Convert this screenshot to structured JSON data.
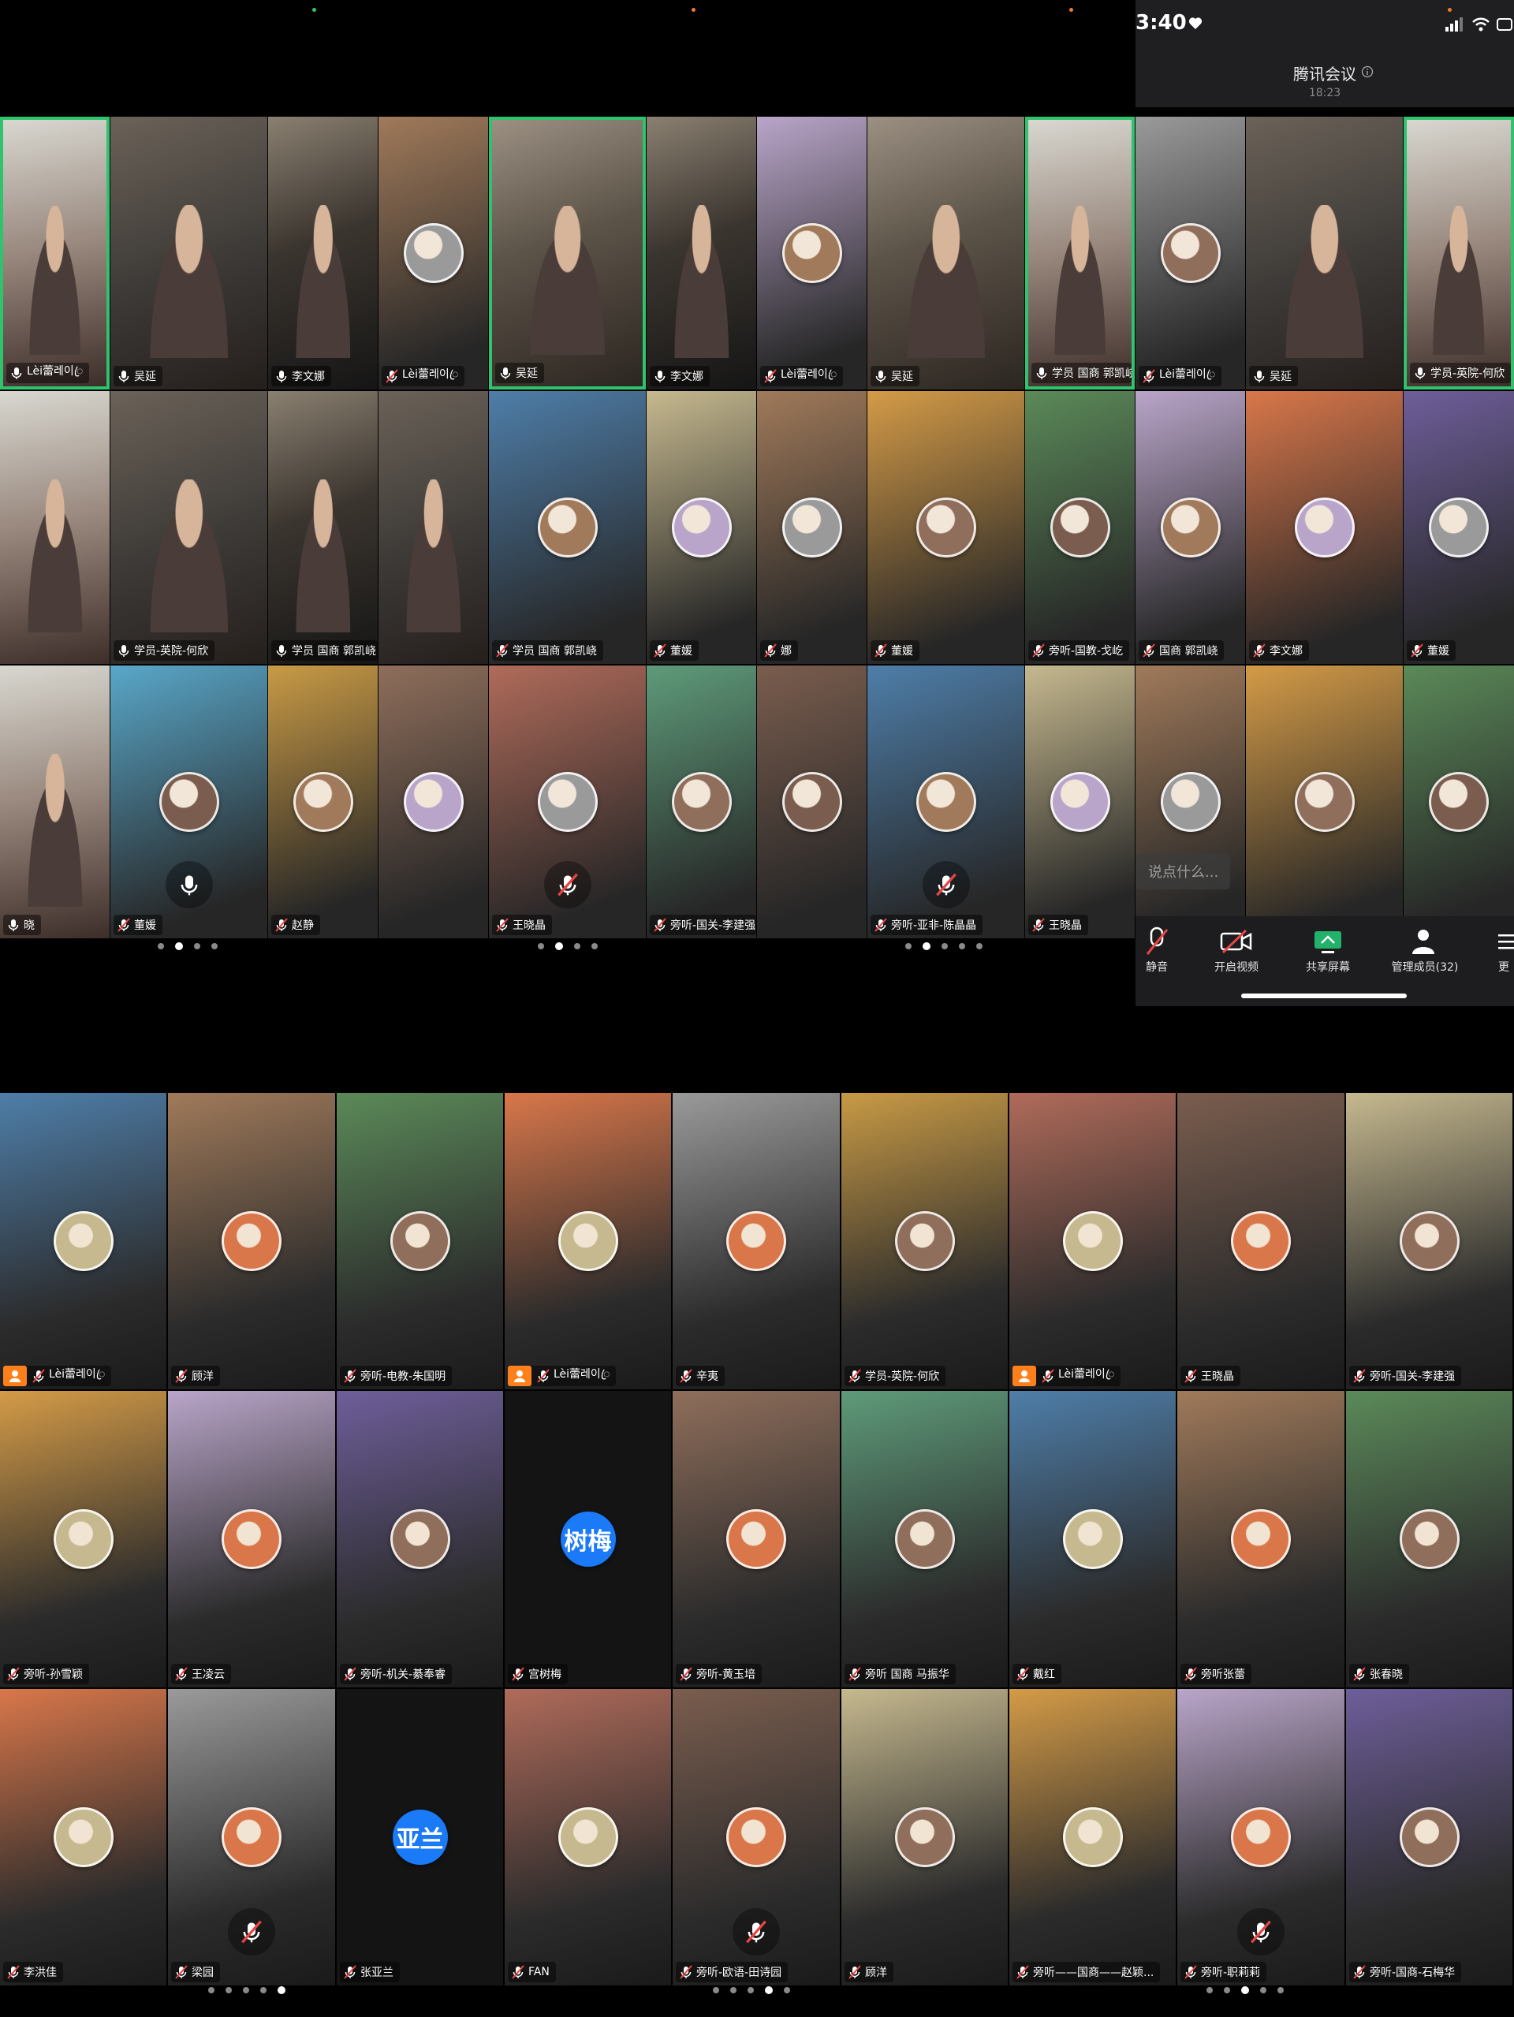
{
  "status": {
    "time": "3:40",
    "meeting_title": "腾讯会议",
    "duration": "18:23"
  },
  "chat": {
    "placeholder": "说点什么..."
  },
  "toolbar": {
    "mute": "静音",
    "video": "开启视频",
    "share": "共享屏幕",
    "members": "管理成员(32)",
    "more": "更"
  },
  "top_tiles": [
    {
      "name": "Lèi蕾레이ꦿ",
      "kind": "video"
    },
    {
      "name": "吴延",
      "kind": "video"
    },
    {
      "name": "李文娜",
      "kind": "video"
    },
    {
      "name": "Lèi蕾레이ꦿ",
      "kind": "avatar"
    },
    {
      "name": "吴延",
      "kind": "video"
    },
    {
      "name": "李文娜",
      "kind": "video"
    },
    {
      "name": "Lèi蕾레이ꦿ",
      "kind": "avatar"
    },
    {
      "name": "吴延",
      "kind": "video"
    },
    {
      "name": "学员 国商 郭凯峣",
      "kind": "video"
    },
    {
      "name": "Lèi蕾레이ꦿ",
      "kind": "avatar"
    },
    {
      "name": "吴延",
      "kind": "video"
    },
    {
      "name": "学员-英院-何欣",
      "kind": "video"
    },
    {
      "name": "",
      "kind": "video"
    },
    {
      "name": "学员-英院-何欣",
      "kind": "video"
    },
    {
      "name": "学员 国商 郭凯峣",
      "kind": "video"
    },
    {
      "name": "",
      "kind": "video"
    },
    {
      "name": "学员 国商 郭凯峣",
      "kind": "avatar"
    },
    {
      "name": "董媛",
      "kind": "avatar"
    },
    {
      "name": "娜",
      "kind": "avatar"
    },
    {
      "name": "董媛",
      "kind": "avatar"
    },
    {
      "name": "旁听-国教-戈屹",
      "kind": "avatar"
    },
    {
      "name": "国商 郭凯峣",
      "kind": "avatar"
    },
    {
      "name": "李文娜",
      "kind": "avatar"
    },
    {
      "name": "董媛",
      "kind": "avatar"
    },
    {
      "name": "晓",
      "kind": "video"
    },
    {
      "name": "董媛",
      "kind": "avatar"
    },
    {
      "name": "赵静",
      "kind": "avatar"
    },
    {
      "name": "",
      "kind": "avatar"
    },
    {
      "name": "王晓晶",
      "kind": "avatar"
    },
    {
      "name": "旁听-国关-李建强",
      "kind": "avatar"
    },
    {
      "name": "",
      "kind": "avatar"
    },
    {
      "name": "旁听-亚非-陈晶晶",
      "kind": "avatar"
    },
    {
      "name": "王晓晶",
      "kind": "avatar"
    },
    {
      "name": "",
      "kind": "avatar"
    },
    {
      "name": "",
      "kind": "avatar"
    },
    {
      "name": "",
      "kind": "avatar"
    }
  ],
  "bottom_tiles": [
    {
      "name": "Lèi蕾레이ꦿ",
      "host": true,
      "avatar_text": ""
    },
    {
      "name": "顾洋",
      "host": false,
      "avatar_text": ""
    },
    {
      "name": "旁听-电教-朱国明",
      "host": false,
      "avatar_text": ""
    },
    {
      "name": "Lèi蕾레이ꦿ",
      "host": true,
      "avatar_text": ""
    },
    {
      "name": "辛夷",
      "host": false,
      "avatar_text": ""
    },
    {
      "name": "学员-英院-何欣",
      "host": false,
      "avatar_text": ""
    },
    {
      "name": "Lèi蕾레이ꦿ",
      "host": true,
      "avatar_text": ""
    },
    {
      "name": "王晓晶",
      "host": false,
      "avatar_text": ""
    },
    {
      "name": "旁听-国关-李建强",
      "host": false,
      "avatar_text": ""
    },
    {
      "name": "旁听-孙雪颖",
      "host": false,
      "avatar_text": ""
    },
    {
      "name": "王凌云",
      "host": false,
      "avatar_text": ""
    },
    {
      "name": "旁听-机关-綦奉睿",
      "host": false,
      "avatar_text": ""
    },
    {
      "name": "宫树梅",
      "host": false,
      "avatar_text": "树梅"
    },
    {
      "name": "旁听-黄玉培",
      "host": false,
      "avatar_text": ""
    },
    {
      "name": "旁听 国商 马振华",
      "host": false,
      "avatar_text": ""
    },
    {
      "name": "戴红",
      "host": false,
      "avatar_text": ""
    },
    {
      "name": "旁听张蕾",
      "host": false,
      "avatar_text": ""
    },
    {
      "name": "张春晓",
      "host": false,
      "avatar_text": ""
    },
    {
      "name": "李洪佳",
      "host": false,
      "avatar_text": ""
    },
    {
      "name": "梁园",
      "host": false,
      "avatar_text": ""
    },
    {
      "name": "张亚兰",
      "host": false,
      "avatar_text": "亚兰"
    },
    {
      "name": "FAN",
      "host": false,
      "avatar_text": ""
    },
    {
      "name": "旁听-欧语-田诗园",
      "host": false,
      "avatar_text": ""
    },
    {
      "name": "顾洋",
      "host": false,
      "avatar_text": ""
    },
    {
      "name": "旁听——国商——赵颖...",
      "host": false,
      "avatar_text": ""
    },
    {
      "name": "旁听-职莉莉",
      "host": false,
      "avatar_text": ""
    },
    {
      "name": "旁听-国商-石梅华",
      "host": false,
      "avatar_text": ""
    }
  ],
  "colors": {
    "active_border": "#2fc36d",
    "host_badge": "#ff7f1a",
    "text_avatar": "#1a7af8"
  }
}
